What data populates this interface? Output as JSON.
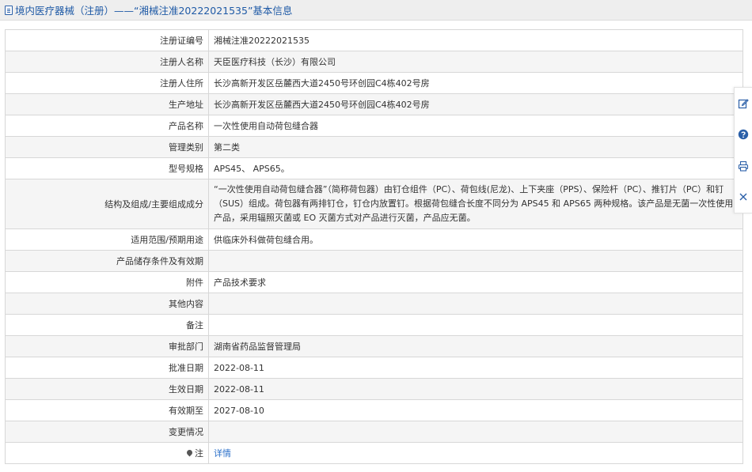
{
  "header": {
    "title": "境内医疗器械（注册）——“湘械注准20222021535”基本信息"
  },
  "rows": [
    {
      "label": "注册证编号",
      "value": "湘械注准20222021535"
    },
    {
      "label": "注册人名称",
      "value": "天臣医疗科技（长沙）有限公司"
    },
    {
      "label": "注册人住所",
      "value": "长沙高新开发区岳麓西大道2450号环创园C4栋402号房"
    },
    {
      "label": "生产地址",
      "value": "长沙高新开发区岳麓西大道2450号环创园C4栋402号房"
    },
    {
      "label": "产品名称",
      "value": "一次性使用自动荷包缝合器"
    },
    {
      "label": "管理类别",
      "value": "第二类"
    },
    {
      "label": "型号规格",
      "value": "APS45、 APS65。"
    },
    {
      "label": "结构及组成/主要组成成分",
      "value": "“一次性使用自动荷包缝合器”（简称荷包器）由钉仓组件（PC）、荷包线(尼龙)、上下夹座（PPS）、保险杆（PC）、推钉片（PC）和钉（SUS）组成。荷包器有两排钉仓，钉仓内放置钉。根据荷包缝合长度不同分为 APS45 和 APS65 两种规格。该产品是无菌一次性使用产品，采用辐照灭菌或 EO 灭菌方式对产品进行灭菌，产品应无菌。"
    },
    {
      "label": "适用范围/预期用途",
      "value": "供临床外科做荷包缝合用。"
    },
    {
      "label": "产品储存条件及有效期",
      "value": ""
    },
    {
      "label": "附件",
      "value": "产品技术要求"
    },
    {
      "label": "其他内容",
      "value": ""
    },
    {
      "label": "备注",
      "value": ""
    },
    {
      "label": "审批部门",
      "value": "湖南省药品监督管理局"
    },
    {
      "label": "批准日期",
      "value": "2022-08-11"
    },
    {
      "label": "生效日期",
      "value": "2022-08-11"
    },
    {
      "label": "有效期至",
      "value": "2027-08-10"
    },
    {
      "label": "变更情况",
      "value": ""
    },
    {
      "label": "注",
      "value": "详情"
    }
  ],
  "toolbar": {
    "icons": [
      "edit-icon",
      "help-icon",
      "print-icon",
      "close-icon"
    ]
  }
}
